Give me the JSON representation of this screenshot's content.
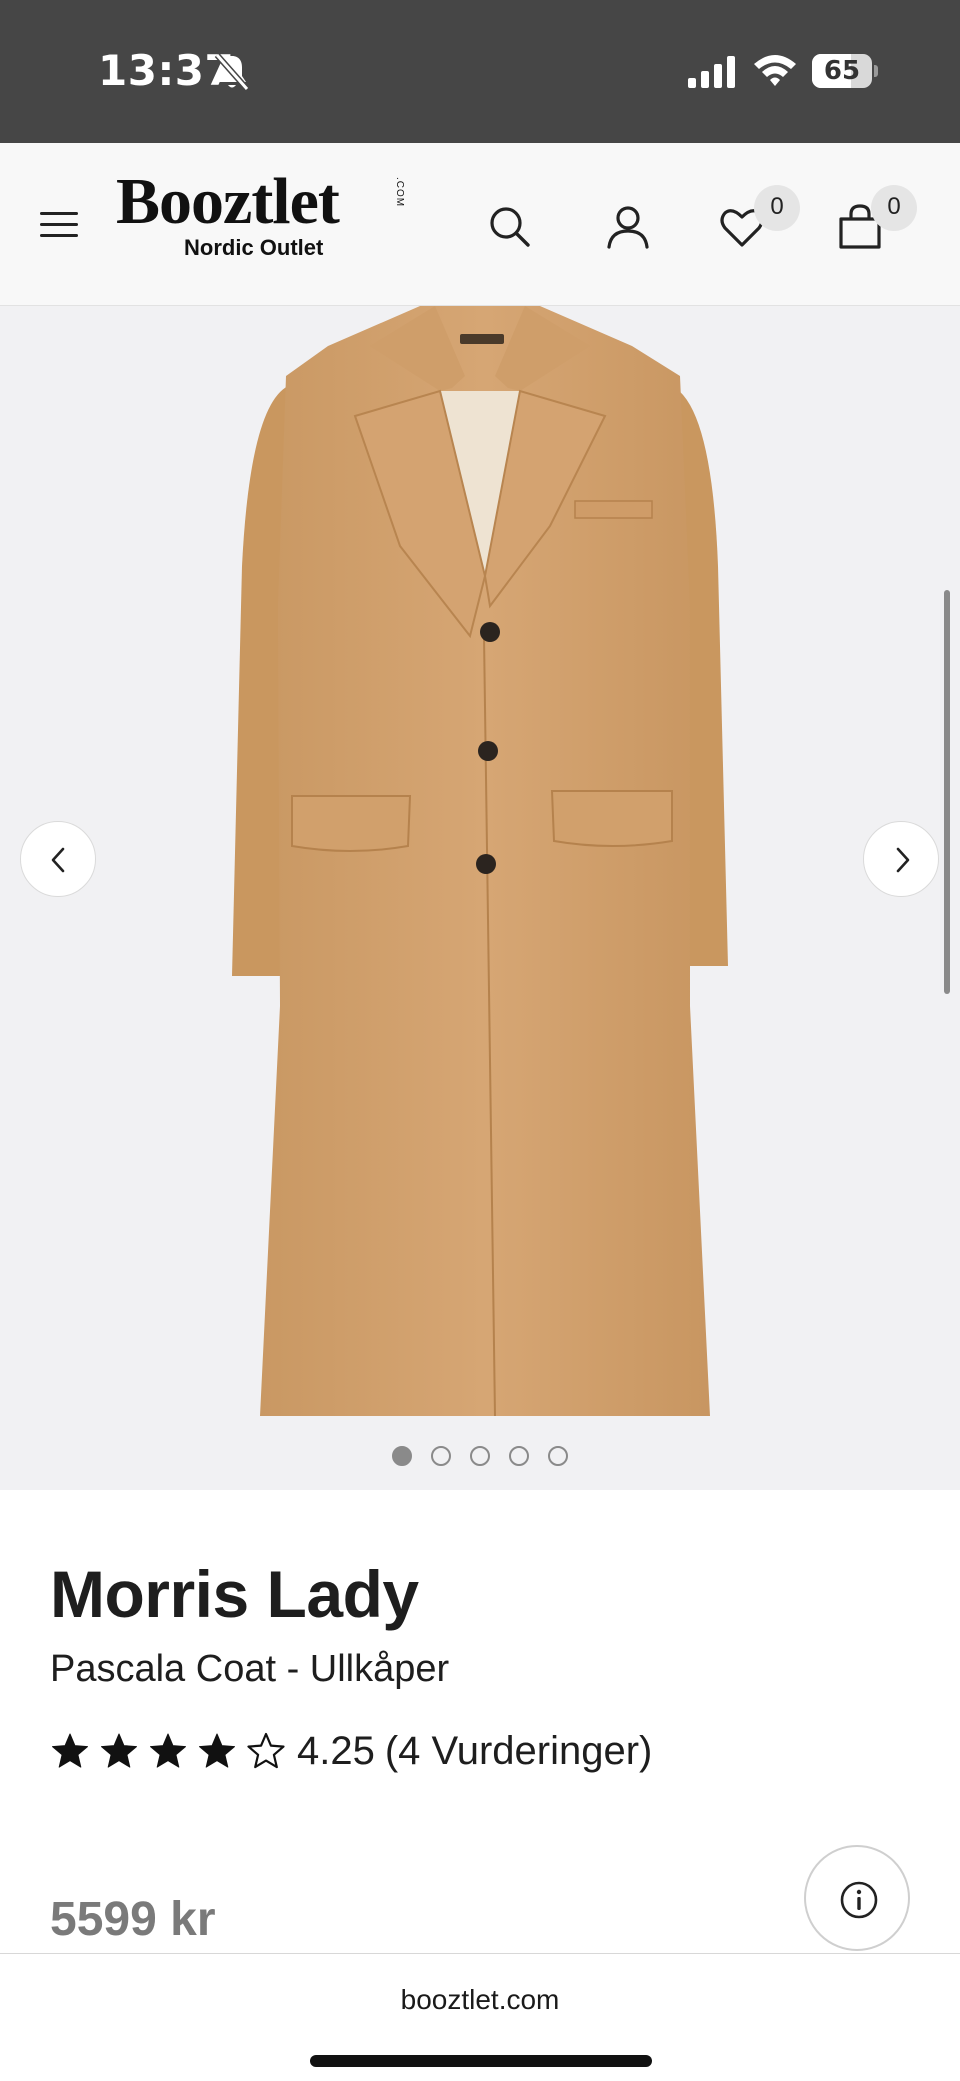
{
  "status_bar": {
    "time": "13:37",
    "battery_level": 65,
    "battery_text": "65",
    "icons": [
      "bell-muted-icon",
      "cellular-signal-icon",
      "wifi-icon",
      "battery-icon"
    ]
  },
  "header": {
    "logo_text": "Booztlet",
    "logo_com": ".COM",
    "logo_subtitle": "Nordic Outlet",
    "wishlist_count": "0",
    "bag_count": "0",
    "icons": [
      "menu-icon",
      "search-icon",
      "account-icon",
      "heart-icon",
      "shopping-bag-icon"
    ]
  },
  "gallery": {
    "image_subject": "camel wool coat",
    "total_images": 5,
    "active_index": 0,
    "colors": {
      "background": "#f1f1f3",
      "coat": "#d2a270"
    }
  },
  "product": {
    "brand": "Morris Lady",
    "name": "Pascala Coat - Ullkåper",
    "rating_value": "4.25",
    "rating_count_text": "(4 Vurderinger)",
    "stars_filled": 4,
    "stars_total": 5,
    "price": "5599 kr"
  },
  "browser": {
    "url": "booztlet.com"
  }
}
